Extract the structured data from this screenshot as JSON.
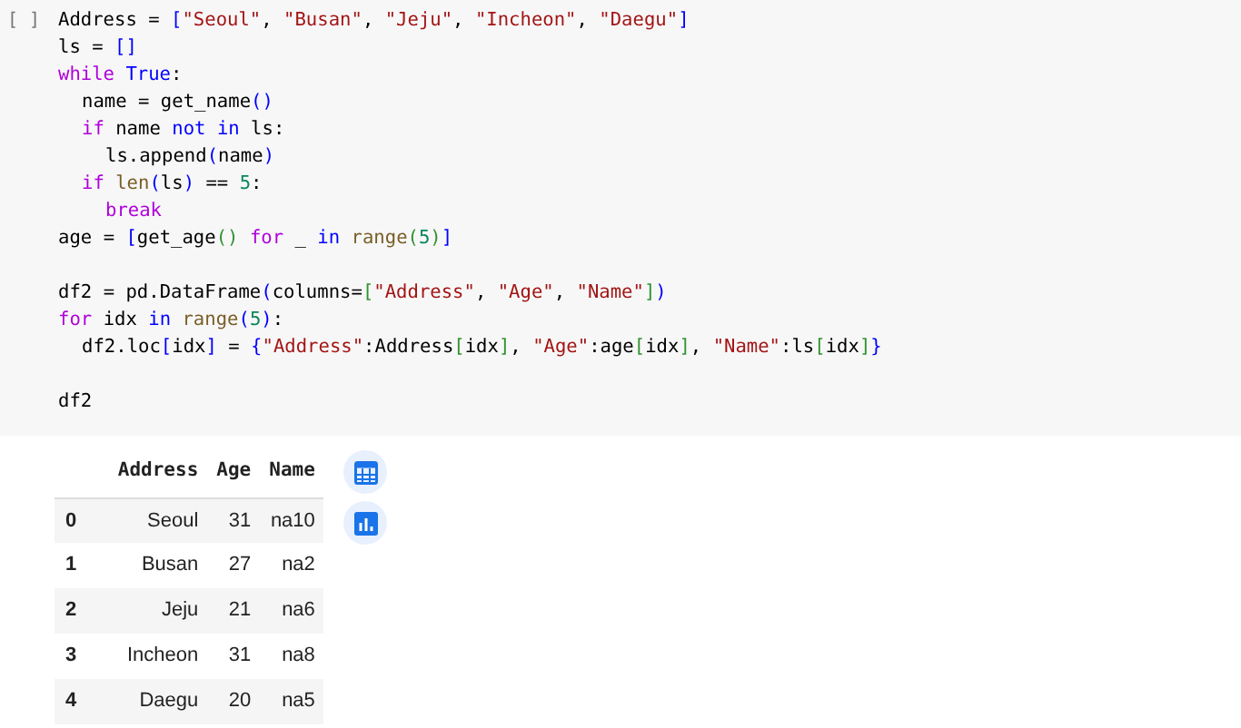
{
  "cell": {
    "run_marker": "[ ]",
    "lines": [
      {
        "text": "Address = [\"Seoul\", \"Busan\", \"Jeju\", \"Incheon\", \"Daegu\"]"
      },
      {
        "text": "ls = []"
      },
      {
        "text": "while True:",
        "children": [
          {
            "text": "name = get_name()"
          },
          {
            "text": "if name not in ls:",
            "children": [
              {
                "text": "ls.append(name)"
              }
            ]
          },
          {
            "text": "if len(ls) == 5:",
            "children": [
              {
                "text": "break"
              }
            ]
          }
        ]
      },
      {
        "text": "age = [get_age() for _ in range(5)]"
      },
      {
        "text": "df2 = pd.DataFrame(columns=[\"Address\", \"Age\", \"Name\"])",
        "gap_before": true
      },
      {
        "text": "for idx in range(5):",
        "children": [
          {
            "text": "df2.loc[idx] = {\"Address\":Address[idx], \"Age\":age[idx], \"Name\":ls[idx]}"
          }
        ]
      },
      {
        "text": "df2",
        "gap_before": true
      }
    ]
  },
  "output": {
    "table": {
      "columns": [
        "Address",
        "Age",
        "Name"
      ],
      "rows": [
        {
          "index": "0",
          "cells": [
            "Seoul",
            "31",
            "na10"
          ]
        },
        {
          "index": "1",
          "cells": [
            "Busan",
            "27",
            "na2"
          ]
        },
        {
          "index": "2",
          "cells": [
            "Jeju",
            "21",
            "na6"
          ]
        },
        {
          "index": "3",
          "cells": [
            "Incheon",
            "31",
            "na8"
          ]
        },
        {
          "index": "4",
          "cells": [
            "Daegu",
            "20",
            "na5"
          ]
        }
      ]
    }
  }
}
